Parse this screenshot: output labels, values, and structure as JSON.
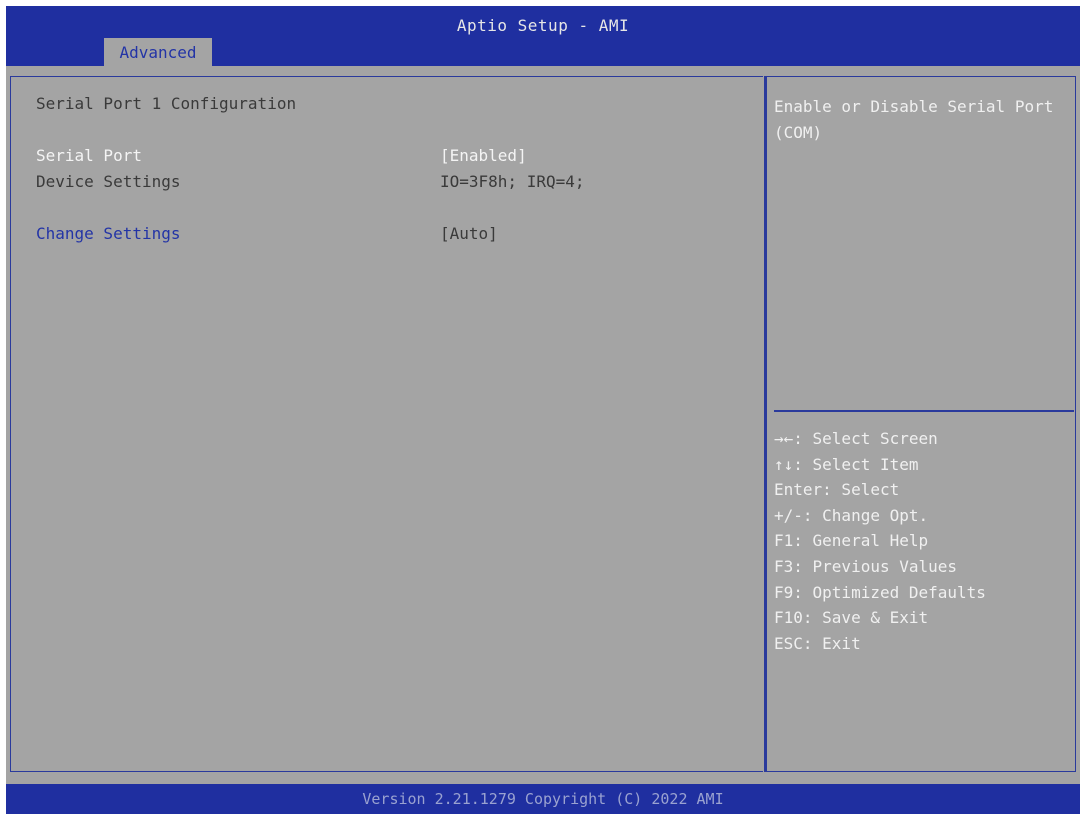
{
  "header": {
    "title": "Aptio Setup - AMI",
    "tab_label": "Advanced"
  },
  "main": {
    "section_title": "Serial Port 1 Configuration",
    "items": [
      {
        "label": "Serial Port",
        "value": "[Enabled]"
      },
      {
        "label": "Device Settings",
        "value": "IO=3F8h; IRQ=4;"
      },
      {
        "label": "Change Settings",
        "value": "[Auto]"
      }
    ]
  },
  "help": {
    "description": "Enable or Disable Serial Port (COM)",
    "keys": [
      "→←: Select Screen",
      "↑↓: Select Item",
      "Enter: Select",
      "+/-: Change Opt.",
      "F1: General Help",
      "F3: Previous Values",
      "F9: Optimized Defaults",
      "F10: Save & Exit",
      "ESC: Exit"
    ]
  },
  "footer": {
    "version": "Version 2.21.1279 Copyright (C) 2022 AMI"
  },
  "colors": {
    "header_blue": "#1f2fa0",
    "background_gray": "#a4a4a4",
    "highlight_white": "#f4f4f4",
    "link_blue": "#2334a6"
  }
}
